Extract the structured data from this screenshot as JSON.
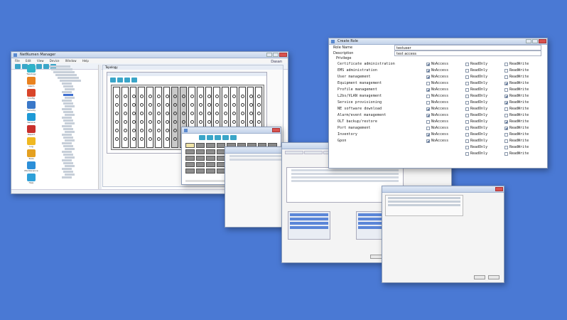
{
  "main_window": {
    "title": "NetNumen Manager",
    "menu": [
      "File",
      "Edit",
      "View",
      "Device",
      "Window",
      "Help"
    ],
    "brand": "Dasan",
    "topology_tab": "Topology",
    "sidebar_icons": [
      {
        "label": "Topology",
        "color": "#2fb3c8"
      },
      {
        "label": "Alarm",
        "color": "#e9821f"
      },
      {
        "label": "Config",
        "color": "#d8452a"
      },
      {
        "label": "Security",
        "color": "#3a78c8"
      },
      {
        "label": "Service",
        "color": "#1e9ad6"
      },
      {
        "label": "Report",
        "color": "#c9302c"
      },
      {
        "label": "Log",
        "color": "#f0b821"
      },
      {
        "label": "Tools",
        "color": "#e4a020"
      },
      {
        "label": "Maintenance",
        "color": "#2c8fd8"
      },
      {
        "label": "Help",
        "color": "#2fa0d8"
      }
    ]
  },
  "create_role": {
    "title": "Create Role",
    "role_name_label": "Role Name",
    "role_name_value": "testuser",
    "description_label": "Description",
    "description_value": "test access",
    "privilege_label": "Privilege",
    "options": [
      "NoAccess",
      "ReadOnly",
      "ReadWrite"
    ],
    "privileges": [
      {
        "name": "Certificate administration",
        "checked": 0
      },
      {
        "name": "EMS administration",
        "checked": 0
      },
      {
        "name": "User management",
        "checked": 0
      },
      {
        "name": "Equipment management",
        "checked": 2
      },
      {
        "name": "Profile management",
        "checked": 0
      },
      {
        "name": "L2bs/VLAN management",
        "checked": 2
      },
      {
        "name": "Service provisioning",
        "checked": 2
      },
      {
        "name": "NE software download",
        "checked": 0
      },
      {
        "name": "Alarm/event management",
        "checked": 0
      },
      {
        "name": "OLT backup/restore",
        "checked": 2
      },
      {
        "name": "Port management",
        "checked": 2
      },
      {
        "name": "Inventory",
        "checked": 0
      },
      {
        "name": "Gpon",
        "checked": 0
      }
    ],
    "extra_rows": 2
  }
}
